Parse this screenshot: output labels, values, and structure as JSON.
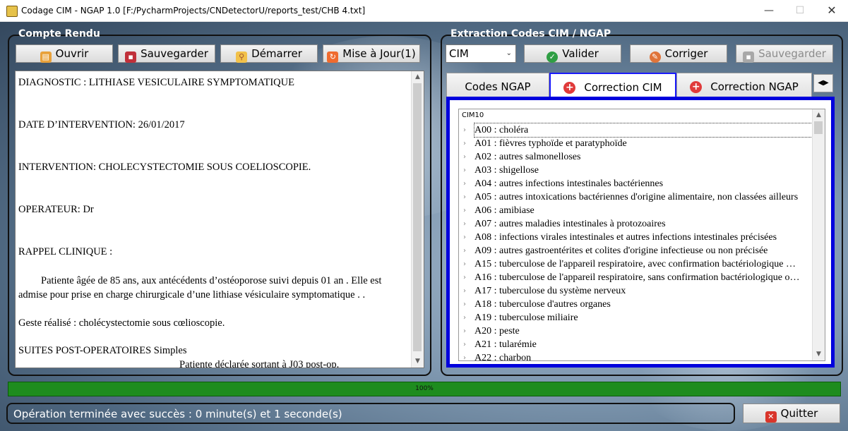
{
  "window": {
    "title": "Codage CIM - NGAP 1.0 [F:/PycharmProjects/CNDetectorU/reports_test/CHB 4.txt]",
    "min_glyph": "—",
    "max_glyph": "☐",
    "close_glyph": "✕"
  },
  "left_panel": {
    "title": "Compte Rendu",
    "buttons": {
      "open": "Ouvrir",
      "save": "Sauvegarder",
      "start": "Démarrer",
      "update": "Mise à Jour(1)"
    },
    "report_lines": [
      "DIAGNOSTIC : LITHIASE VESICULAIRE SYMPTOMATIQUE",
      "DATE D’INTERVENTION: 26/01/2017",
      "INTERVENTION: CHOLECYSTECTOMIE SOUS COELIOSCOPIE.",
      "OPERATEUR: Dr",
      "RAPPEL CLINIQUE :",
      "Patiente âgée de 85 ans, aux antécédents d’ostéoporose suivi depuis 01 an  . Elle est",
      "admise pour prise en charge chirurgicale d’une lithiase vésiculaire symptomatique .         .",
      "Geste réalisé : cholécystectomie sous cœlioscopie.",
      "SUITES POST-OPERATOIRES Simples",
      "Patiente déclarée sortant à J03 post-op."
    ]
  },
  "right_panel": {
    "title": "Extraction Codes CIM / NGAP",
    "combo_value": "CIM",
    "buttons": {
      "validate": "Valider",
      "correct": "Corriger",
      "save": "Sauvegarder"
    },
    "tabs": [
      "Codes NGAP",
      "Correction CIM",
      "Correction NGAP"
    ],
    "active_tab": "Correction CIM",
    "tree_header": "CIM10",
    "tree_items": [
      "A00 : choléra",
      "A01 : fièvres typhoïde et paratyphoïde",
      "A02 : autres salmonelloses",
      "A03 : shigellose",
      "A04 : autres infections intestinales bactériennes",
      "A05 : autres intoxications bactériennes d'origine alimentaire, non classées ailleurs",
      "A06 : amibiase",
      "A07 : autres maladies intestinales à protozoaires",
      "A08 : infections virales intestinales et autres infections intestinales précisées",
      "A09 : autres gastroentérites et colites d'origine infectieuse ou non précisée",
      "A15 : tuberculose de l'appareil respiratoire, avec confirmation bactériologique …",
      "A16 : tuberculose de l'appareil respiratoire, sans confirmation bactériologique o…",
      "A17 : tuberculose du système nerveux",
      "A18 : tuberculose d'autres organes",
      "A19 : tuberculose miliaire",
      "A20 : peste",
      "A21 : tularémie",
      "A22 : charbon"
    ]
  },
  "progress": {
    "label": "100%",
    "value": 1.0
  },
  "status": {
    "text": "Opération terminée avec succès : 0 minute(s) et 1 seconde(s)"
  },
  "quit_label": "Quitter",
  "icons": [
    "app-icon",
    "folder-icon",
    "save-icon",
    "search-icon",
    "refresh-icon",
    "check-icon",
    "edit-icon",
    "plus-icon",
    "error-icon"
  ],
  "colors": {
    "progress": "#1e8c1e",
    "active_tab_border": "#0000dd",
    "background": "#5f7a94"
  }
}
